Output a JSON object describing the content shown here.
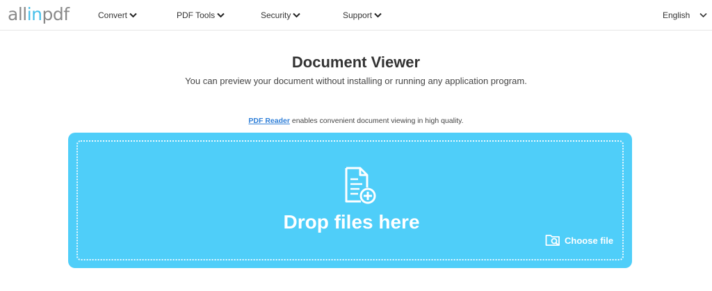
{
  "header": {
    "logo": {
      "part1": "all",
      "part2": "in",
      "part3": "pdf"
    },
    "nav": [
      {
        "label": "Convert"
      },
      {
        "label": "PDF Tools"
      },
      {
        "label": "Security"
      },
      {
        "label": "Support"
      }
    ],
    "language": "English"
  },
  "main": {
    "title": "Document Viewer",
    "subtitle": "You can preview your document without installing or running any application program.",
    "reader_link": "PDF Reader",
    "reader_text": " enables convenient document viewing in high quality."
  },
  "dropzone": {
    "drop_label": "Drop files here",
    "choose_label": "Choose file",
    "background_color": "#4fcef9"
  }
}
